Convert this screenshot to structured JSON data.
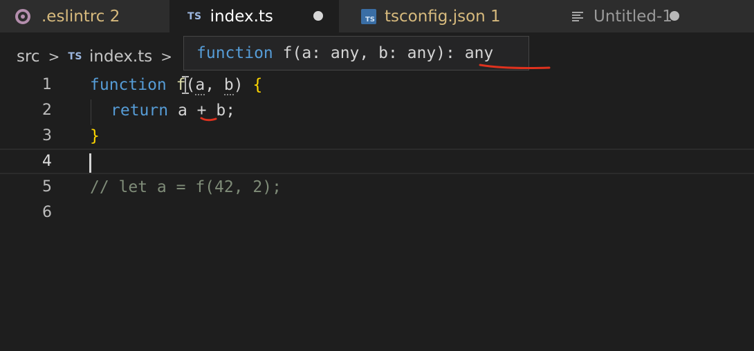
{
  "tabs": [
    {
      "label": ".eslintrc 2",
      "icon": "gear-icon"
    },
    {
      "label": "index.ts",
      "icon_text": "TS",
      "active": true,
      "modified": true
    },
    {
      "label": "tsconfig.json 1",
      "icon_text": "TS"
    },
    {
      "label": "Untitled-1",
      "icon": "lines-icon",
      "modified": true
    }
  ],
  "breadcrumb": {
    "folder": "src",
    "separator": ">",
    "file_icon": "TS",
    "file": "index.ts"
  },
  "tooltip": {
    "keyword": "function",
    "signature": " f(a: any, b: any): ",
    "return_type": "any"
  },
  "editor": {
    "line_numbers": [
      "1",
      "2",
      "3",
      "4",
      "5",
      "6"
    ],
    "line1": {
      "kw": "function",
      "name": "f",
      "open": "(",
      "a": "a",
      "comma": ", ",
      "b": "b",
      "close": ") ",
      "brace": "{"
    },
    "line2": {
      "kw": "return",
      "rest1": " a ",
      "op": "+",
      "rest2": " b;"
    },
    "line3": {
      "brace": "}"
    },
    "line5": {
      "comment": "// let a = f(42, 2);"
    }
  },
  "colors": {
    "background": "#1e1e1e",
    "keyword": "#569cd6",
    "brace": "#ffd700",
    "annotation": "#e0321e"
  }
}
